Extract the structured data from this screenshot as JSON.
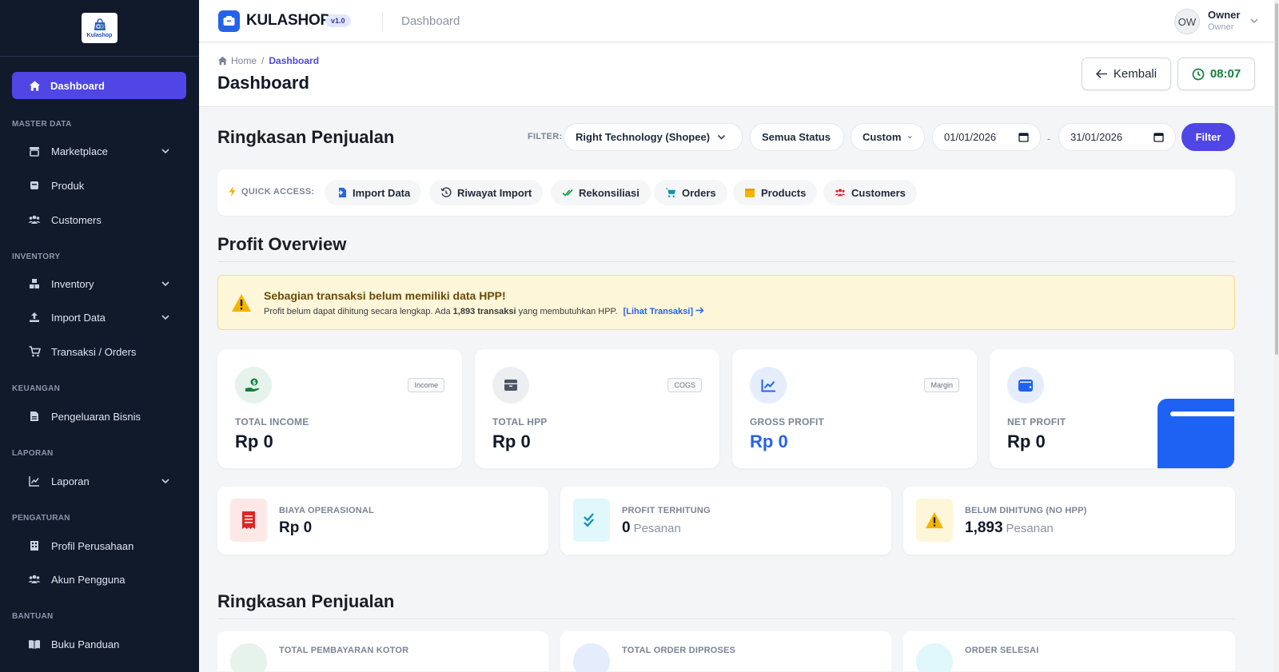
{
  "app": {
    "brand": "KULASHOP",
    "version": "v1.0",
    "logo_text": "Kulashop",
    "current_page": "Dashboard"
  },
  "user": {
    "initials": "OW",
    "name": "Owner",
    "role": "Owner"
  },
  "sidebar": {
    "active": {
      "label": "Dashboard",
      "icon": "home-icon"
    },
    "sections": {
      "master": "MASTER DATA",
      "inventory": "INVENTORY",
      "keuangan": "KEUANGAN",
      "laporan": "LAPORAN",
      "pengaturan": "PENGATURAN",
      "bantuan": "BANTUAN"
    },
    "items": {
      "marketplace": "Marketplace",
      "produk": "Produk",
      "customers": "Customers",
      "inventory": "Inventory",
      "import_data": "Import Data",
      "transaksi": "Transaksi / Orders",
      "pengeluaran": "Pengeluaran Bisnis",
      "laporan": "Laporan",
      "profil": "Profil Perusahaan",
      "akun": "Akun Pengguna",
      "panduan": "Buku Panduan"
    }
  },
  "page_header": {
    "breadcrumb_home": "Home",
    "breadcrumb_sep": "/",
    "breadcrumb_current": "Dashboard",
    "title": "Dashboard",
    "back_label": "Kembali",
    "clock": "08:07"
  },
  "summary": {
    "title": "Ringkasan Penjualan",
    "filter_label": "FILTER:",
    "store": "Right Technology (Shopee)",
    "status": "Semua Status",
    "period": "Custom",
    "date_from": "01/01/2026",
    "date_sep": "-",
    "date_to": "31/01/2026",
    "filter_button": "Filter"
  },
  "quick_access": {
    "label": "QUICK ACCESS:",
    "items": {
      "import": "Import Data",
      "riwayat": "Riwayat Import",
      "rekon": "Rekonsiliasi",
      "orders": "Orders",
      "products": "Products",
      "customers": "Customers"
    }
  },
  "profit": {
    "title": "Profit Overview",
    "warning_title": "Sebagian transaksi belum memiliki data HPP!",
    "warning_text_before": "Profit belum dapat dihitung secara lengkap. Ada ",
    "warning_count": "1,893 transaksi",
    "warning_text_after": " yang membutuhkan HPP.",
    "warning_link": "[Lihat Transaksi]",
    "cards": {
      "income": {
        "tag": "Income",
        "label": "TOTAL INCOME",
        "value": "Rp 0"
      },
      "hpp": {
        "tag": "COGS",
        "label": "TOTAL HPP",
        "value": "Rp 0"
      },
      "gross": {
        "tag": "Margin",
        "label": "GROSS PROFIT",
        "value": "Rp 0"
      },
      "net": {
        "label": "NET PROFIT",
        "value": "Rp 0"
      }
    },
    "stats": {
      "biaya": {
        "label": "BIAYA OPERASIONAL",
        "value": "Rp 0"
      },
      "terhitung": {
        "label": "PROFIT TERHITUNG",
        "value": "0",
        "unit": "Pesanan"
      },
      "belum": {
        "label": "BELUM DIHITUNG (NO HPP)",
        "value": "1,893",
        "unit": "Pesanan"
      }
    }
  },
  "sales": {
    "title": "Ringkasan Penjualan",
    "mini": {
      "kotor": "TOTAL PEMBAYARAN KOTOR",
      "diproses": "TOTAL ORDER DIPROSES",
      "selesai": "ORDER SELESAI"
    }
  },
  "colors": {
    "sidebar_bg": "#111a2b",
    "accent": "#4f46e5",
    "brand_blue": "#2563eb",
    "warning_bg": "#fef6d9",
    "success": "#15803d"
  }
}
